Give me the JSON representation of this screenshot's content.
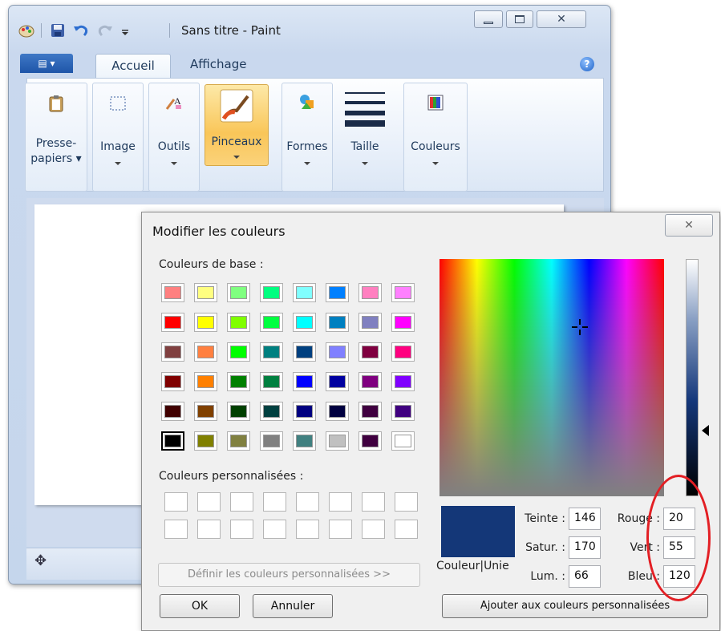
{
  "paint": {
    "title": "Sans titre - Paint",
    "tabs": [
      "Accueil",
      "Affichage"
    ],
    "groups": [
      {
        "label": "Presse-papiers"
      },
      {
        "label": "Image"
      },
      {
        "label": "Outils"
      },
      {
        "label": "Pinceaux"
      },
      {
        "label": "Formes"
      },
      {
        "label": "Taille"
      },
      {
        "label": "Couleurs"
      }
    ],
    "caption_buttons": [
      "minimize",
      "maximize",
      "close"
    ],
    "help": "?"
  },
  "dialog": {
    "title": "Modifier les couleurs",
    "close_glyph": "X",
    "basic_colors_label": "Couleurs de base :",
    "custom_colors_label": "Couleurs personnalisées :",
    "basic_colors": [
      [
        "#ff8080",
        "#ffff80",
        "#80ff80",
        "#00ff80",
        "#80ffff",
        "#0080ff",
        "#ff80c0",
        "#ff80ff"
      ],
      [
        "#ff0000",
        "#ffff00",
        "#80ff00",
        "#00ff40",
        "#00ffff",
        "#0080c0",
        "#8080c0",
        "#ff00ff"
      ],
      [
        "#804040",
        "#ff8040",
        "#00ff00",
        "#008080",
        "#004080",
        "#8080ff",
        "#800040",
        "#ff0080"
      ],
      [
        "#800000",
        "#ff8000",
        "#008000",
        "#008040",
        "#0000ff",
        "#0000a0",
        "#800080",
        "#8000ff"
      ],
      [
        "#400000",
        "#804000",
        "#004000",
        "#004040",
        "#000080",
        "#000040",
        "#400040",
        "#400080"
      ],
      [
        "#000000",
        "#808000",
        "#808040",
        "#808080",
        "#408080",
        "#c0c0c0",
        "#400040",
        "#ffffff"
      ]
    ],
    "selected_basic": [
      5,
      0
    ],
    "define_button": "Définir les couleurs personnalisées >>",
    "ok_button": "OK",
    "cancel_button": "Annuler",
    "add_button": "Ajouter aux couleurs personnalisées",
    "preview_label": "Couleur|Unie",
    "preview_color": "#143778",
    "fields": {
      "teinte": {
        "label": "Teinte :",
        "value": "146"
      },
      "satur": {
        "label": "Satur. :",
        "value": "170"
      },
      "lum": {
        "label": "Lum. :",
        "value": "66"
      },
      "rouge": {
        "label": "Rouge :",
        "value": "20"
      },
      "vert": {
        "label": "Vert :",
        "value": "55"
      },
      "bleu": {
        "label": "Bleu :",
        "value": "120"
      }
    }
  },
  "annotation": {
    "color": "#e31f24"
  }
}
